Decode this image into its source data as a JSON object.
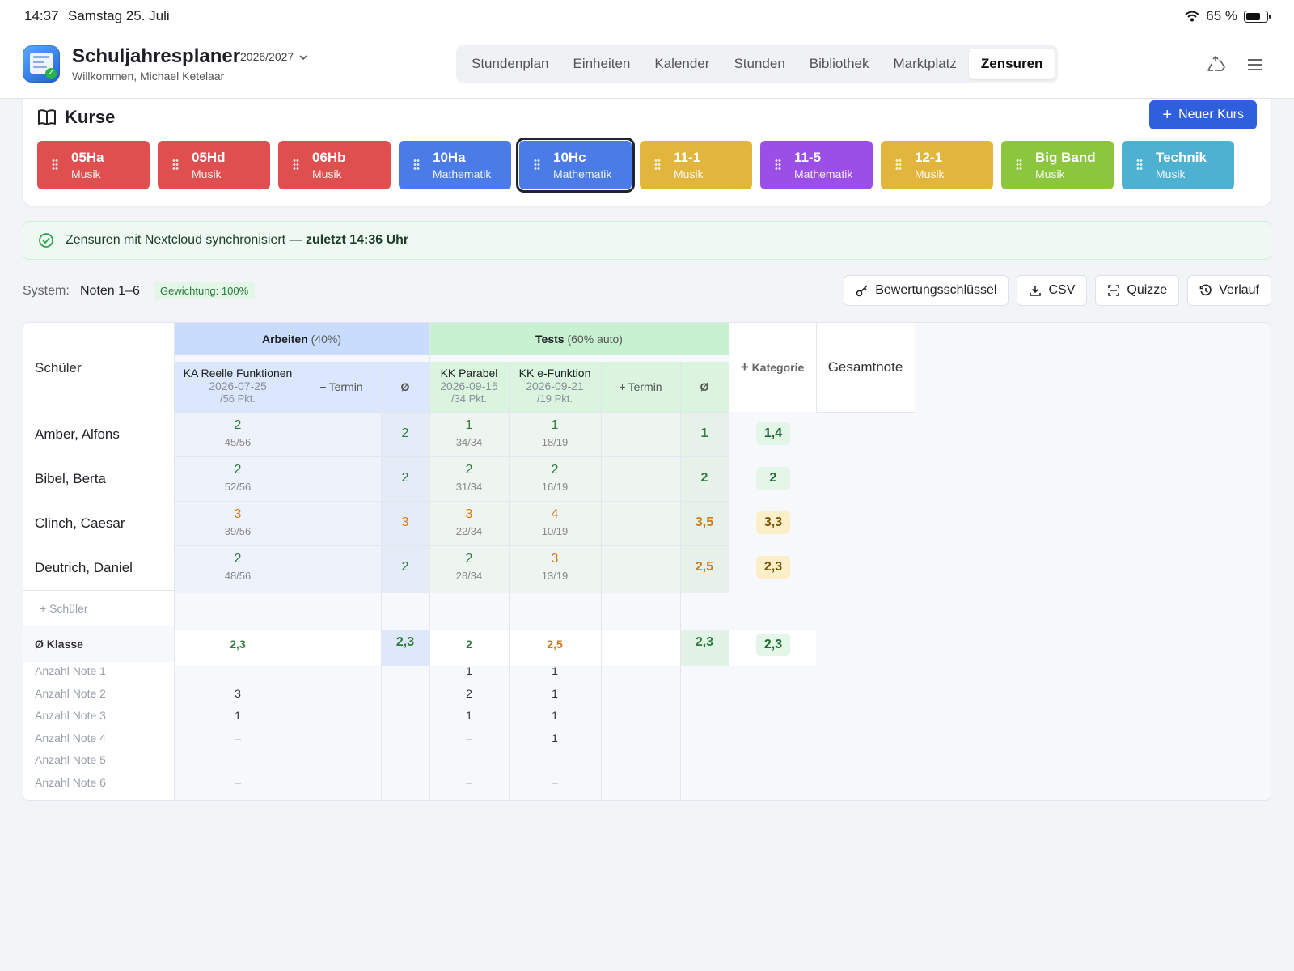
{
  "status": {
    "time": "14:37",
    "date": "Samstag 25. Juli",
    "battery": "65 %",
    "battery_level": 0.65
  },
  "header": {
    "app_title": "Schuljahresplaner",
    "welcome": "Willkommen, Michael Ketelaar",
    "year": "2026/2027",
    "tabs": [
      "Stundenplan",
      "Einheiten",
      "Kalender",
      "Stunden",
      "Bibliothek",
      "Marktplatz",
      "Zensuren"
    ],
    "active_tab": "Zensuren"
  },
  "courses": {
    "title": "Kurse",
    "new_button": "Neuer Kurs",
    "items": [
      {
        "name": "05Ha",
        "subject": "Musik",
        "color": "#e04f4f"
      },
      {
        "name": "05Hd",
        "subject": "Musik",
        "color": "#e04f4f"
      },
      {
        "name": "06Hb",
        "subject": "Musik",
        "color": "#e04f4f"
      },
      {
        "name": "10Ha",
        "subject": "Mathematik",
        "color": "#4a7be6"
      },
      {
        "name": "10Hc",
        "subject": "Mathematik",
        "color": "#4a7be6"
      },
      {
        "name": "11-1",
        "subject": "Musik",
        "color": "#e2b53d"
      },
      {
        "name": "11-5",
        "subject": "Mathematik",
        "color": "#9b4fe6"
      },
      {
        "name": "12-1",
        "subject": "Musik",
        "color": "#e2b53d"
      },
      {
        "name": "Big Band",
        "subject": "Musik",
        "color": "#8cc63f"
      },
      {
        "name": "Technik",
        "subject": "Musik",
        "color": "#4fb1d1"
      }
    ],
    "selected": "10Hc"
  },
  "sync": {
    "text": "Zensuren mit Nextcloud synchronisiert — ",
    "bold": "zuletzt 14:36 Uhr"
  },
  "system": {
    "label": "System:",
    "value": "Noten 1–6",
    "weight": "Gewichtung: 100%"
  },
  "toolbar": {
    "key": "Bewertungsschlüssel",
    "csv": "CSV",
    "quizze": "Quizze",
    "history": "Verlauf"
  },
  "table": {
    "student_header": "Schüler",
    "category_add": "Kategorie",
    "total_header": "Gesamtnote",
    "termin_label": "Termin",
    "avg_symbol": "Ø",
    "arbeiten": {
      "name": "Arbeiten",
      "weight": "(40%)"
    },
    "tests": {
      "name": "Tests",
      "weight": "(60% auto)"
    },
    "cols": [
      {
        "title": "KA Reelle Funktionen",
        "date": "2026-07-25",
        "max": "/56 Pkt."
      },
      {
        "title": "KK Parabel",
        "date": "2026-09-15",
        "max": "/34 Pkt."
      },
      {
        "title": "KK e-Funktion",
        "date": "2026-09-21",
        "max": "/19 Pkt."
      }
    ],
    "students": [
      {
        "name": "Amber, Alfons",
        "ka": [
          "2",
          "45/56"
        ],
        "arb_avg": "2",
        "kk1": [
          "1",
          "34/34"
        ],
        "kk2": [
          "1",
          "18/19"
        ],
        "test_avg": "1",
        "total": "1,4",
        "total_style": "green"
      },
      {
        "name": "Bibel, Berta",
        "ka": [
          "2",
          "52/56"
        ],
        "arb_avg": "2",
        "kk1": [
          "2",
          "31/34"
        ],
        "kk2": [
          "2",
          "16/19"
        ],
        "test_avg": "2",
        "total": "2",
        "total_style": "green"
      },
      {
        "name": "Clinch, Caesar",
        "ka": [
          "3",
          "39/56"
        ],
        "arb_avg": "3",
        "kk1": [
          "3",
          "22/34"
        ],
        "kk2": [
          "4",
          "10/19"
        ],
        "test_avg": "3,5",
        "total": "3,3",
        "total_style": "yellow"
      },
      {
        "name": "Deutrich, Daniel",
        "ka": [
          "2",
          "48/56"
        ],
        "arb_avg": "2",
        "kk1": [
          "2",
          "28/34"
        ],
        "kk2": [
          "3",
          "13/19"
        ],
        "test_avg": "2,5",
        "total": "2,3",
        "total_style": "yellow"
      }
    ],
    "add_student": "Schüler",
    "class_avg": {
      "label": "Ø Klasse",
      "ka": "2,3",
      "arb_avg": "2,3",
      "kk1": "2",
      "kk2": "2,5",
      "test_avg": "2,3",
      "total": "2,3"
    },
    "stats": [
      {
        "label": "Anzahl Note 1",
        "ka": "–",
        "kk1": "1",
        "kk2": "1"
      },
      {
        "label": "Anzahl Note 2",
        "ka": "3",
        "kk1": "2",
        "kk2": "1"
      },
      {
        "label": "Anzahl Note 3",
        "ka": "1",
        "kk1": "1",
        "kk2": "1"
      },
      {
        "label": "Anzahl Note 4",
        "ka": "–",
        "kk1": "–",
        "kk2": "1"
      },
      {
        "label": "Anzahl Note 5",
        "ka": "–",
        "kk1": "–",
        "kk2": "–"
      },
      {
        "label": "Anzahl Note 6",
        "ka": "–",
        "kk1": "–",
        "kk2": "–"
      }
    ]
  },
  "colors": {
    "accent": "#2f5fdc",
    "arbeiten_header": "#c9dcfb",
    "tests_header": "#c8f1d2",
    "good": "#2e7d3e",
    "warn": "#d07a1a"
  }
}
